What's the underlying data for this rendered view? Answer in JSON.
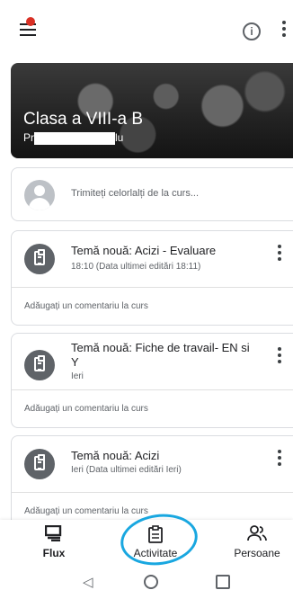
{
  "header": {
    "info_icon": "info-icon",
    "menu_icon": "hamburger-menu-icon",
    "more_icon": "more-vert-icon"
  },
  "banner": {
    "class_name": "Clasa a VIII-a B",
    "subtitle_prefix": "Pr",
    "subtitle_suffix": "lu"
  },
  "share": {
    "placeholder": "Trimiteți celorlalți de la curs..."
  },
  "posts": [
    {
      "title": "Temă nouă: Acizi - Evaluare",
      "meta": "18:10 (Data ultimei editări 18:11)",
      "comment": "Adăugați un comentariu la curs"
    },
    {
      "title": "Temă nouă: Fiche de travail- EN si Y",
      "meta": "Ieri",
      "comment": "Adăugați un comentariu la curs"
    },
    {
      "title": "Temă nouă: Acizi",
      "meta": "Ieri (Data ultimei editări Ieri)",
      "comment": "Adăugați un comentariu la curs"
    }
  ],
  "bottom_nav": {
    "items": [
      {
        "label": "Flux",
        "icon": "stream-icon"
      },
      {
        "label": "Activitate",
        "icon": "classwork-icon"
      },
      {
        "label": "Persoane",
        "icon": "people-icon"
      }
    ],
    "selected": "Flux"
  },
  "colors": {
    "accent_annotation": "#19a7e0",
    "notification_dot": "#d93025"
  }
}
